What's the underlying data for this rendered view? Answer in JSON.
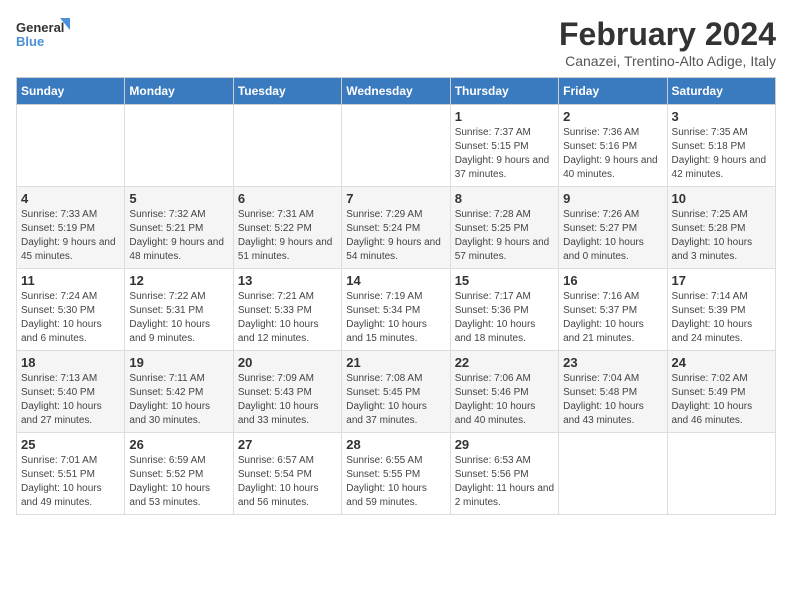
{
  "logo": {
    "line1": "General",
    "line2": "Blue"
  },
  "title": "February 2024",
  "subtitle": "Canazei, Trentino-Alto Adige, Italy",
  "days_of_week": [
    "Sunday",
    "Monday",
    "Tuesday",
    "Wednesday",
    "Thursday",
    "Friday",
    "Saturday"
  ],
  "weeks": [
    [
      {
        "day": "",
        "info": ""
      },
      {
        "day": "",
        "info": ""
      },
      {
        "day": "",
        "info": ""
      },
      {
        "day": "",
        "info": ""
      },
      {
        "day": "1",
        "info": "Sunrise: 7:37 AM\nSunset: 5:15 PM\nDaylight: 9 hours and 37 minutes."
      },
      {
        "day": "2",
        "info": "Sunrise: 7:36 AM\nSunset: 5:16 PM\nDaylight: 9 hours and 40 minutes."
      },
      {
        "day": "3",
        "info": "Sunrise: 7:35 AM\nSunset: 5:18 PM\nDaylight: 9 hours and 42 minutes."
      }
    ],
    [
      {
        "day": "4",
        "info": "Sunrise: 7:33 AM\nSunset: 5:19 PM\nDaylight: 9 hours and 45 minutes."
      },
      {
        "day": "5",
        "info": "Sunrise: 7:32 AM\nSunset: 5:21 PM\nDaylight: 9 hours and 48 minutes."
      },
      {
        "day": "6",
        "info": "Sunrise: 7:31 AM\nSunset: 5:22 PM\nDaylight: 9 hours and 51 minutes."
      },
      {
        "day": "7",
        "info": "Sunrise: 7:29 AM\nSunset: 5:24 PM\nDaylight: 9 hours and 54 minutes."
      },
      {
        "day": "8",
        "info": "Sunrise: 7:28 AM\nSunset: 5:25 PM\nDaylight: 9 hours and 57 minutes."
      },
      {
        "day": "9",
        "info": "Sunrise: 7:26 AM\nSunset: 5:27 PM\nDaylight: 10 hours and 0 minutes."
      },
      {
        "day": "10",
        "info": "Sunrise: 7:25 AM\nSunset: 5:28 PM\nDaylight: 10 hours and 3 minutes."
      }
    ],
    [
      {
        "day": "11",
        "info": "Sunrise: 7:24 AM\nSunset: 5:30 PM\nDaylight: 10 hours and 6 minutes."
      },
      {
        "day": "12",
        "info": "Sunrise: 7:22 AM\nSunset: 5:31 PM\nDaylight: 10 hours and 9 minutes."
      },
      {
        "day": "13",
        "info": "Sunrise: 7:21 AM\nSunset: 5:33 PM\nDaylight: 10 hours and 12 minutes."
      },
      {
        "day": "14",
        "info": "Sunrise: 7:19 AM\nSunset: 5:34 PM\nDaylight: 10 hours and 15 minutes."
      },
      {
        "day": "15",
        "info": "Sunrise: 7:17 AM\nSunset: 5:36 PM\nDaylight: 10 hours and 18 minutes."
      },
      {
        "day": "16",
        "info": "Sunrise: 7:16 AM\nSunset: 5:37 PM\nDaylight: 10 hours and 21 minutes."
      },
      {
        "day": "17",
        "info": "Sunrise: 7:14 AM\nSunset: 5:39 PM\nDaylight: 10 hours and 24 minutes."
      }
    ],
    [
      {
        "day": "18",
        "info": "Sunrise: 7:13 AM\nSunset: 5:40 PM\nDaylight: 10 hours and 27 minutes."
      },
      {
        "day": "19",
        "info": "Sunrise: 7:11 AM\nSunset: 5:42 PM\nDaylight: 10 hours and 30 minutes."
      },
      {
        "day": "20",
        "info": "Sunrise: 7:09 AM\nSunset: 5:43 PM\nDaylight: 10 hours and 33 minutes."
      },
      {
        "day": "21",
        "info": "Sunrise: 7:08 AM\nSunset: 5:45 PM\nDaylight: 10 hours and 37 minutes."
      },
      {
        "day": "22",
        "info": "Sunrise: 7:06 AM\nSunset: 5:46 PM\nDaylight: 10 hours and 40 minutes."
      },
      {
        "day": "23",
        "info": "Sunrise: 7:04 AM\nSunset: 5:48 PM\nDaylight: 10 hours and 43 minutes."
      },
      {
        "day": "24",
        "info": "Sunrise: 7:02 AM\nSunset: 5:49 PM\nDaylight: 10 hours and 46 minutes."
      }
    ],
    [
      {
        "day": "25",
        "info": "Sunrise: 7:01 AM\nSunset: 5:51 PM\nDaylight: 10 hours and 49 minutes."
      },
      {
        "day": "26",
        "info": "Sunrise: 6:59 AM\nSunset: 5:52 PM\nDaylight: 10 hours and 53 minutes."
      },
      {
        "day": "27",
        "info": "Sunrise: 6:57 AM\nSunset: 5:54 PM\nDaylight: 10 hours and 56 minutes."
      },
      {
        "day": "28",
        "info": "Sunrise: 6:55 AM\nSunset: 5:55 PM\nDaylight: 10 hours and 59 minutes."
      },
      {
        "day": "29",
        "info": "Sunrise: 6:53 AM\nSunset: 5:56 PM\nDaylight: 11 hours and 2 minutes."
      },
      {
        "day": "",
        "info": ""
      },
      {
        "day": "",
        "info": ""
      }
    ]
  ]
}
